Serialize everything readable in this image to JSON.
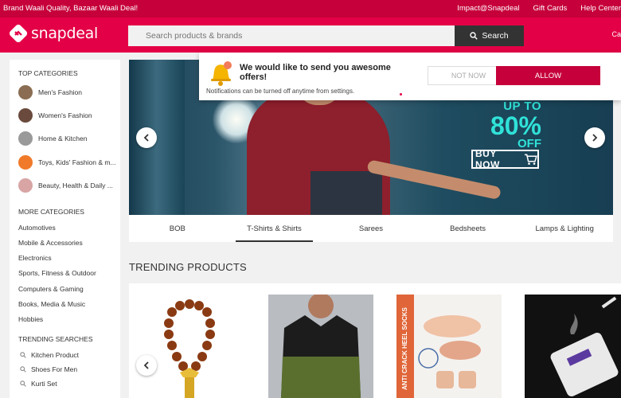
{
  "topstrip": {
    "promo": "Brand Waali Quality, Bazaar Waali Deal!",
    "links": [
      "Impact@Snapdeal",
      "Gift Cards",
      "Help Center"
    ]
  },
  "header": {
    "logo_text": "snapdeal",
    "search_placeholder": "Search products & brands",
    "search_button": "Search",
    "cart_partial": "Ca"
  },
  "sidebar": {
    "top_categories_title": "TOP CATEGORIES",
    "top_categories": [
      {
        "label": "Men's Fashion",
        "color": "#8a6d52"
      },
      {
        "label": "Women's Fashion",
        "color": "#6a4a3c"
      },
      {
        "label": "Home & Kitchen",
        "color": "#9a9a9a"
      },
      {
        "label": "Toys, Kids' Fashion & m...",
        "color": "#f07a2a"
      },
      {
        "label": "Beauty, Health & Daily ...",
        "color": "#d9a4a4"
      }
    ],
    "more_categories_title": "MORE CATEGORIES",
    "more_categories": [
      "Automotives",
      "Mobile & Accessories",
      "Electronics",
      "Sports, Fitness & Outdoor",
      "Computers & Gaming",
      "Books, Media & Music",
      "Hobbies"
    ],
    "trending_searches_title": "TRENDING SEARCHES",
    "trending_searches": [
      "Kitchen Product",
      "Shoes For Men",
      "Kurti Set"
    ]
  },
  "banner": {
    "upto": "UP TO",
    "percent": "80%",
    "off": "OFF",
    "buy_now": "BUY NOW"
  },
  "tabs": [
    "BOB",
    "T-Shirts & Shirts",
    "Sarees",
    "Bedsheets",
    "Lamps & Lighting"
  ],
  "active_tab": "T-Shirts & Shirts",
  "trending": {
    "title": "TRENDING PRODUCTS",
    "socks_text": "ANTI CRACK HEEL SOCKS"
  },
  "notification": {
    "message": "We would like to send you awesome offers!",
    "sub": "Notifications can be turned off anytime from settings.",
    "not_now": "NOT NOW",
    "allow": "ALLOW"
  },
  "colors": {
    "brand": "#e40046",
    "strip": "#c6003a",
    "promo_cyan": "#30e2d8"
  }
}
